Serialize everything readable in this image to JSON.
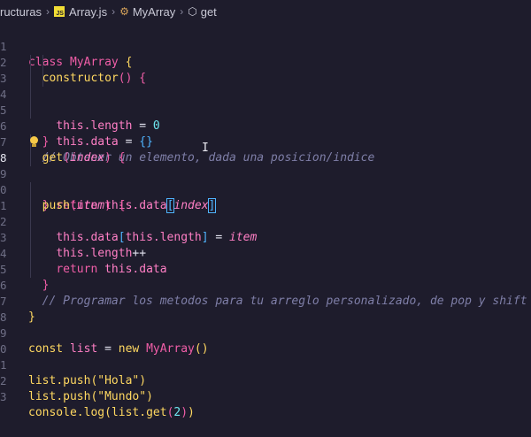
{
  "breadcrumb": {
    "folder": "ructuras",
    "file": "Array.js",
    "file_icon_text": "JS",
    "class_name": "MyArray",
    "method_name": "get"
  },
  "lines": [
    {
      "n": "1"
    },
    {
      "n": "2"
    },
    {
      "n": "3"
    },
    {
      "n": "4"
    },
    {
      "n": "5"
    },
    {
      "n": "6"
    },
    {
      "n": "7"
    },
    {
      "n": "8"
    },
    {
      "n": "9"
    },
    {
      "n": "0"
    },
    {
      "n": "1"
    },
    {
      "n": "2"
    },
    {
      "n": "3"
    },
    {
      "n": "4"
    },
    {
      "n": "5"
    },
    {
      "n": "6"
    },
    {
      "n": "7"
    },
    {
      "n": "8"
    },
    {
      "n": "9"
    },
    {
      "n": "0"
    },
    {
      "n": "1"
    },
    {
      "n": "2"
    },
    {
      "n": "3"
    }
  ],
  "code": {
    "l1": {
      "kw": "class ",
      "cls": "MyArray",
      "rest": " {"
    },
    "l2": {
      "fn": "constructor",
      "rest": "() {"
    },
    "l3": {
      "this": "this",
      "prop": ".length",
      "op": " = ",
      "num": "0"
    },
    "l4": {
      "this": "this",
      "prop": ".data",
      "op": " = ",
      "br": "{}"
    },
    "l5": {
      "br": "}"
    },
    "l6": {
      "cmt": "// Obtener un elemento, dada una posicion/indice"
    },
    "l7": {
      "fn": "get",
      "open": "(",
      "param": "index",
      "close": ") {"
    },
    "l8": {
      "kw": "return ",
      "this": "this",
      "prop": ".data",
      "open": "[",
      "param": "index",
      "close": "]"
    },
    "l9": {
      "br": "}"
    },
    "l10": {
      "fn": "push",
      "open": "(",
      "param": "item",
      "close": ") {"
    },
    "l11": {
      "this": "this",
      "prop": ".data",
      "open": "[",
      "this2": "this",
      "prop2": ".length",
      "close": "]",
      "op": " = ",
      "param": "item"
    },
    "l12": {
      "this": "this",
      "prop": ".length",
      "op": "++"
    },
    "l13": {
      "kw": "return ",
      "this": "this",
      "prop": ".data"
    },
    "l14": {
      "br": "}"
    },
    "l15": {
      "cmt": "// Programar los metodos para tu arreglo personalizado, de pop y shift"
    },
    "l17": {
      "br": "}"
    },
    "l19": {
      "kw": "const ",
      "var": "list",
      "op": " = ",
      "kw2": "new ",
      "cls": "MyArray",
      "br": "()"
    },
    "l21": {
      "var": "list",
      "prop": ".push",
      "open": "(",
      "str": "\"Hola\"",
      "close": ")"
    },
    "l22": {
      "var": "list",
      "prop": ".push",
      "open": "(",
      "str": "\"Mundo\"",
      "close": ")"
    },
    "l23": {
      "var": "console",
      "prop": ".log",
      "open": "(",
      "var2": "list",
      "prop2": ".get",
      "open2": "(",
      "num": "2",
      "close2": ")",
      "close": ")"
    }
  },
  "colors": {
    "background": "#1e1c2c",
    "keyword": "#f15ea8",
    "function": "#ffd861",
    "number": "#6ee7f0",
    "comment": "#7f7fa8"
  }
}
